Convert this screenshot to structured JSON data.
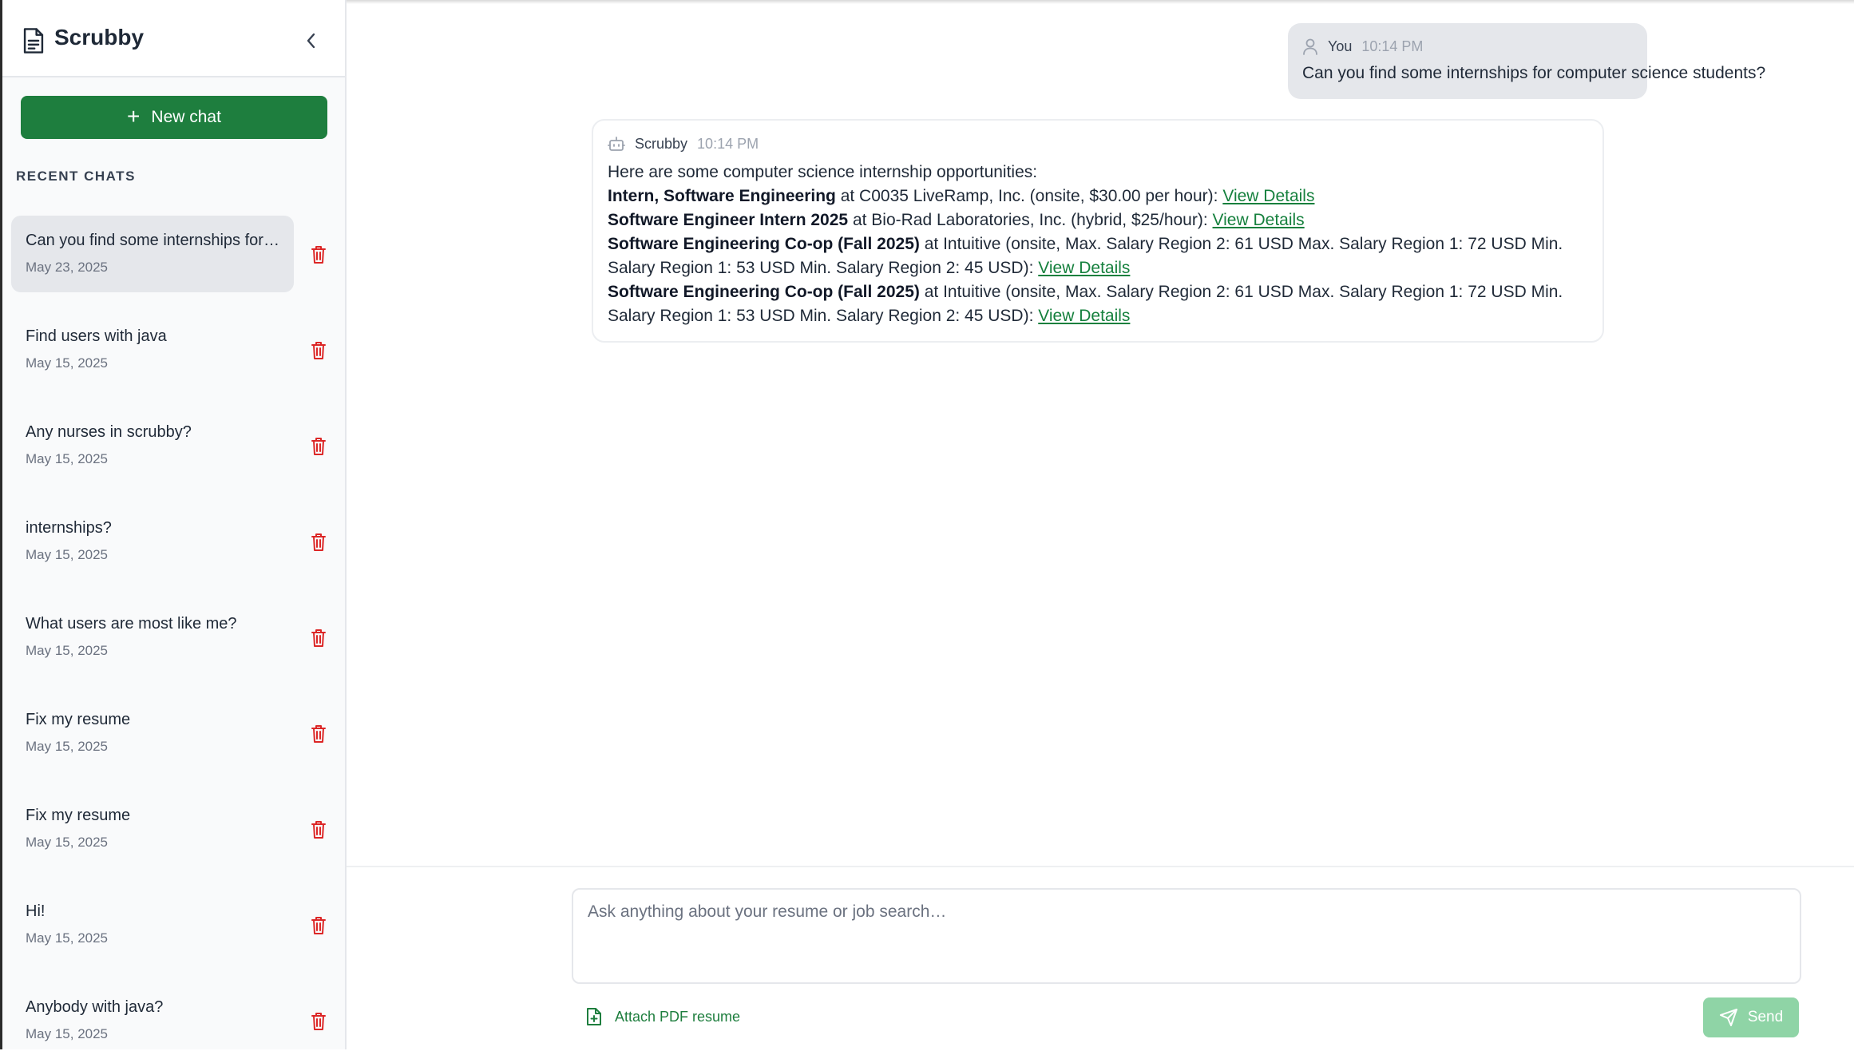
{
  "sidebar": {
    "title": "Scrubby",
    "new_chat_label": "New chat",
    "recent_label": "RECENT CHATS",
    "chats": [
      {
        "title": "Can you find some internships for computer science students?",
        "date": "May 23, 2025",
        "active": true
      },
      {
        "title": "Find users with java",
        "date": "May 15, 2025"
      },
      {
        "title": "Any nurses in scrubby?",
        "date": "May 15, 2025"
      },
      {
        "title": "internships?",
        "date": "May 15, 2025"
      },
      {
        "title": "What users are most like me?",
        "date": "May 15, 2025"
      },
      {
        "title": "Fix my resume",
        "date": "May 15, 2025"
      },
      {
        "title": "Fix my resume",
        "date": "May 15, 2025"
      },
      {
        "title": "Hi!",
        "date": "May 15, 2025"
      },
      {
        "title": "Anybody with java?",
        "date": "May 15, 2025"
      }
    ]
  },
  "messages": {
    "user": {
      "name": "You",
      "time": "10:14 PM",
      "text": "Can you find some internships for computer science students?"
    },
    "bot": {
      "name": "Scrubby",
      "time": "10:14 PM",
      "intro": "Here are some computer science internship opportunities:",
      "items": [
        {
          "title": "Intern, Software Engineering",
          "text": " at C0035 LiveRamp, Inc. (onsite, $30.00 per hour): ",
          "link": "View Details"
        },
        {
          "title": "Software Engineer Intern 2025",
          "text": " at Bio-Rad Laboratories, Inc. (hybrid, $25/hour): ",
          "link": "View Details"
        },
        {
          "title": "Software Engineering Co-op (Fall 2025)",
          "text": " at Intuitive (onsite, Max. Salary Region 2: 61 USD Max. Salary Region 1: 72 USD Min. Salary Region 1: 53 USD Min. Salary Region 2: 45 USD): ",
          "link": "View Details"
        },
        {
          "title": "Software Engineering Co-op (Fall 2025)",
          "text": " at Intuitive (onsite, Max. Salary Region 2: 61 USD Max. Salary Region 1: 72 USD Min. Salary Region 1: 53 USD Min. Salary Region 2: 45 USD): ",
          "link": "View Details"
        }
      ]
    }
  },
  "composer": {
    "placeholder": "Ask anything about your resume or job search…",
    "attach_label": "Attach PDF resume",
    "send_label": "Send"
  },
  "colors": {
    "accent": "#1e7e3e",
    "link": "#15803d",
    "delete": "#dc2626",
    "send_disabled": "#8fd4a6"
  },
  "icons": [
    "document-icon",
    "chevron-left-icon",
    "plus-icon",
    "trash-icon",
    "user-icon",
    "bot-icon",
    "file-plus-icon",
    "send-icon"
  ]
}
